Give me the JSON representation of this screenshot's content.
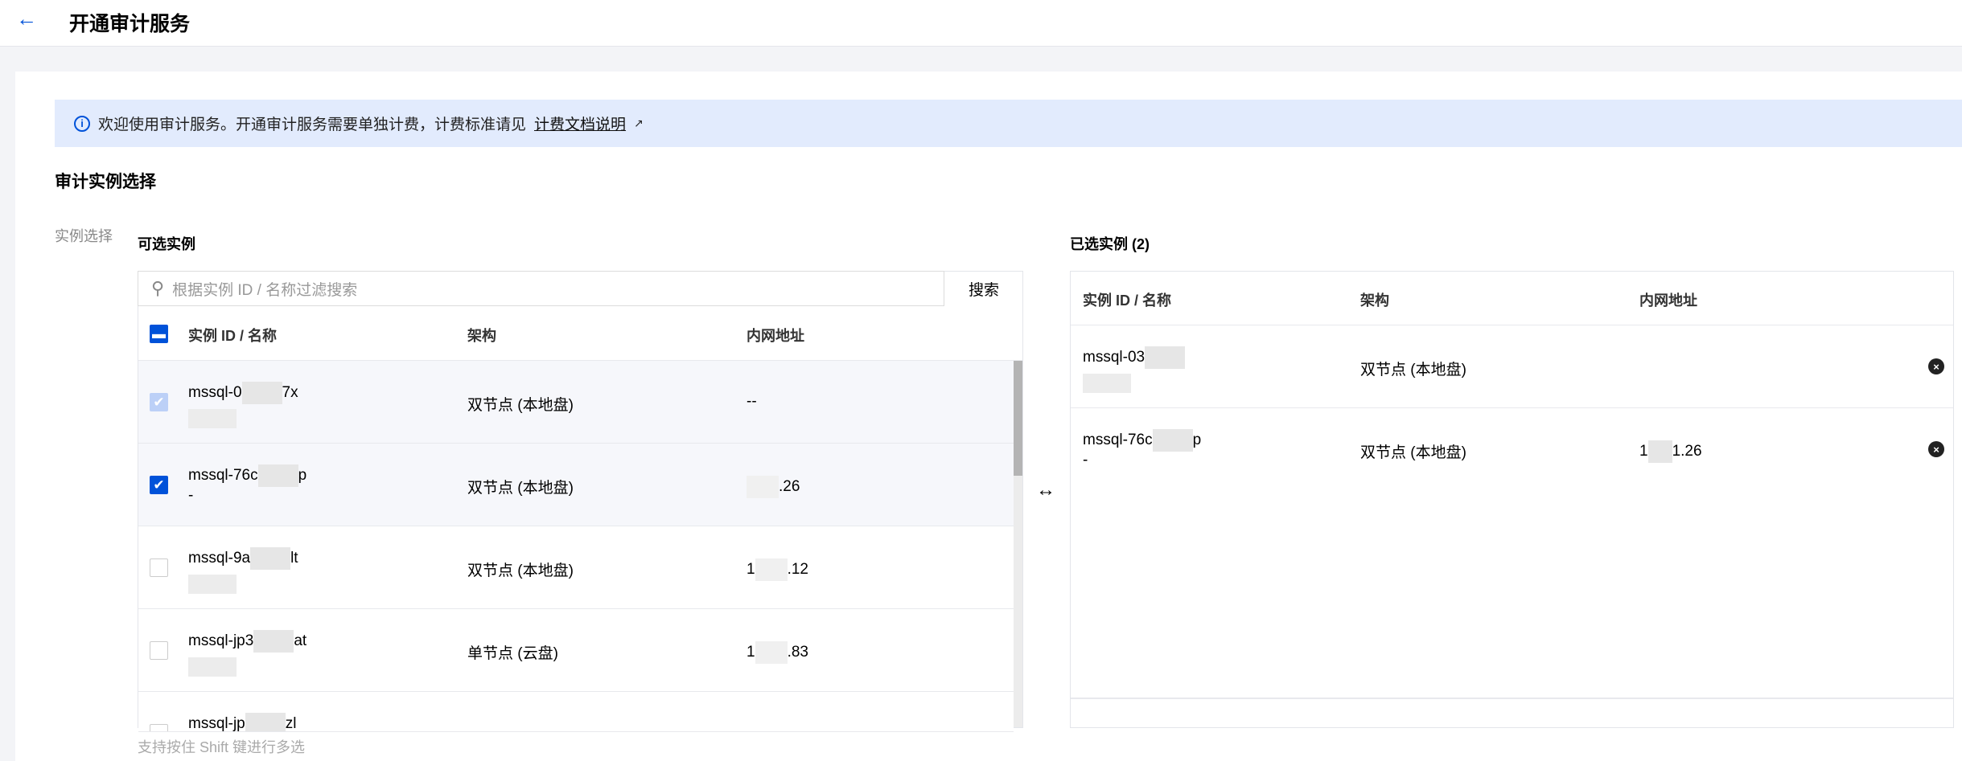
{
  "header": {
    "title": "开通审计服务",
    "back_icon": "arrow-left-icon"
  },
  "banner": {
    "text": "欢迎使用审计服务。开通审计服务需要单独计费，计费标准请见",
    "link": "计费文档说明"
  },
  "section_title": "审计实例选择",
  "field_label": "实例选择",
  "available": {
    "title": "可选实例",
    "search_placeholder": "根据实例 ID / 名称过滤搜索",
    "search_button": "搜索",
    "columns": [
      "实例 ID / 名称",
      "架构",
      "内网地址"
    ],
    "rows": [
      {
        "id_prefix": "mssql-0",
        "id_suffix": "7x",
        "name": "",
        "arch": "双节点 (本地盘)",
        "ip_prefix": "",
        "ip_suffix": "--",
        "state": "disabled"
      },
      {
        "id_prefix": "mssql-76c",
        "id_suffix": "p",
        "name": "-",
        "arch": "双节点 (本地盘)",
        "ip_prefix": "",
        "ip_suffix": ".26",
        "state": "checked"
      },
      {
        "id_prefix": "mssql-9a",
        "id_suffix": "lt",
        "name": "",
        "arch": "双节点 (本地盘)",
        "ip_prefix": "1",
        "ip_suffix": ".12",
        "state": "unchecked"
      },
      {
        "id_prefix": "mssql-jp3",
        "id_suffix": "at",
        "name": "",
        "arch": "单节点 (云盘)",
        "ip_prefix": "1",
        "ip_suffix": ".83",
        "state": "unchecked"
      },
      {
        "id_prefix": "mssql-jp",
        "id_suffix": "zl",
        "name": "",
        "arch": "",
        "ip_prefix": "",
        "ip_suffix": "",
        "state": "unchecked"
      }
    ],
    "hint": "支持按住 Shift 键进行多选"
  },
  "selected": {
    "title": "已选实例 (2)",
    "columns": [
      "实例 ID / 名称",
      "架构",
      "内网地址"
    ],
    "rows": [
      {
        "id_prefix": "mssql-03",
        "id_suffix": "",
        "name": "",
        "arch": "双节点 (本地盘)",
        "ip_prefix": "",
        "ip_suffix": ""
      },
      {
        "id_prefix": "mssql-76c",
        "id_suffix": "p",
        "name": "-",
        "arch": "双节点 (本地盘)",
        "ip_prefix": "1",
        "ip_suffix": "1.26"
      }
    ]
  },
  "colors": {
    "accent": "#0052d9",
    "banner": "#e2ebfd"
  }
}
